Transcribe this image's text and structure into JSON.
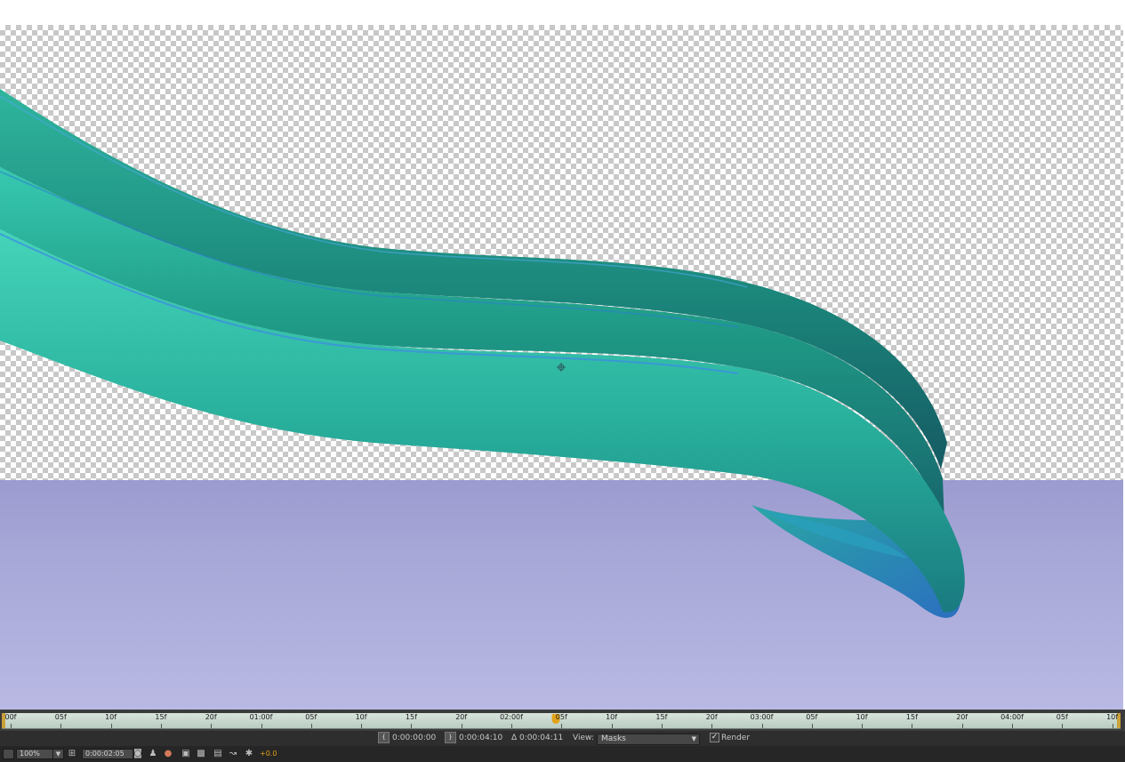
{
  "viewer": {
    "background": "transparency-checkerboard",
    "floor_color": "#b4b4e0",
    "ribbon_colors": [
      "#1fa18b",
      "#2fc3a8",
      "#1c6f78",
      "#3a8fd0"
    ]
  },
  "timeline": {
    "ruler_labels": [
      "00f",
      "05f",
      "10f",
      "15f",
      "20f",
      "01:00f",
      "05f",
      "10f",
      "15f",
      "20f",
      "02:00f",
      "05f",
      "10f",
      "15f",
      "20f",
      "03:00f",
      "05f",
      "10f",
      "15f",
      "20f",
      "04:00f",
      "05f",
      "10f"
    ],
    "playhead_color": "#e3a21a",
    "ruler_color": "#cfe0d6"
  },
  "info_bar": {
    "start_time": "0:00:00:00",
    "end_time": "0:00:04:10",
    "duration": "Δ 0:00:04:11",
    "view_label": "View:",
    "view_value": "Masks",
    "render_label": "Render",
    "render_checked": true
  },
  "bottom_bar": {
    "zoom": "100%",
    "current_time": "0:00:02:05",
    "exposure": "+0.0",
    "icons": [
      "always-preview-icon",
      "zoom-dropdown-icon",
      "grid-icon",
      "timecode-field",
      "camera-snapshot-icon",
      "show-snapshot-icon",
      "color-channels-icon",
      "region-of-interest-icon",
      "transparency-grid-icon",
      "3d-view-icon",
      "fast-preview-icon",
      "exposure-reset-icon"
    ]
  }
}
